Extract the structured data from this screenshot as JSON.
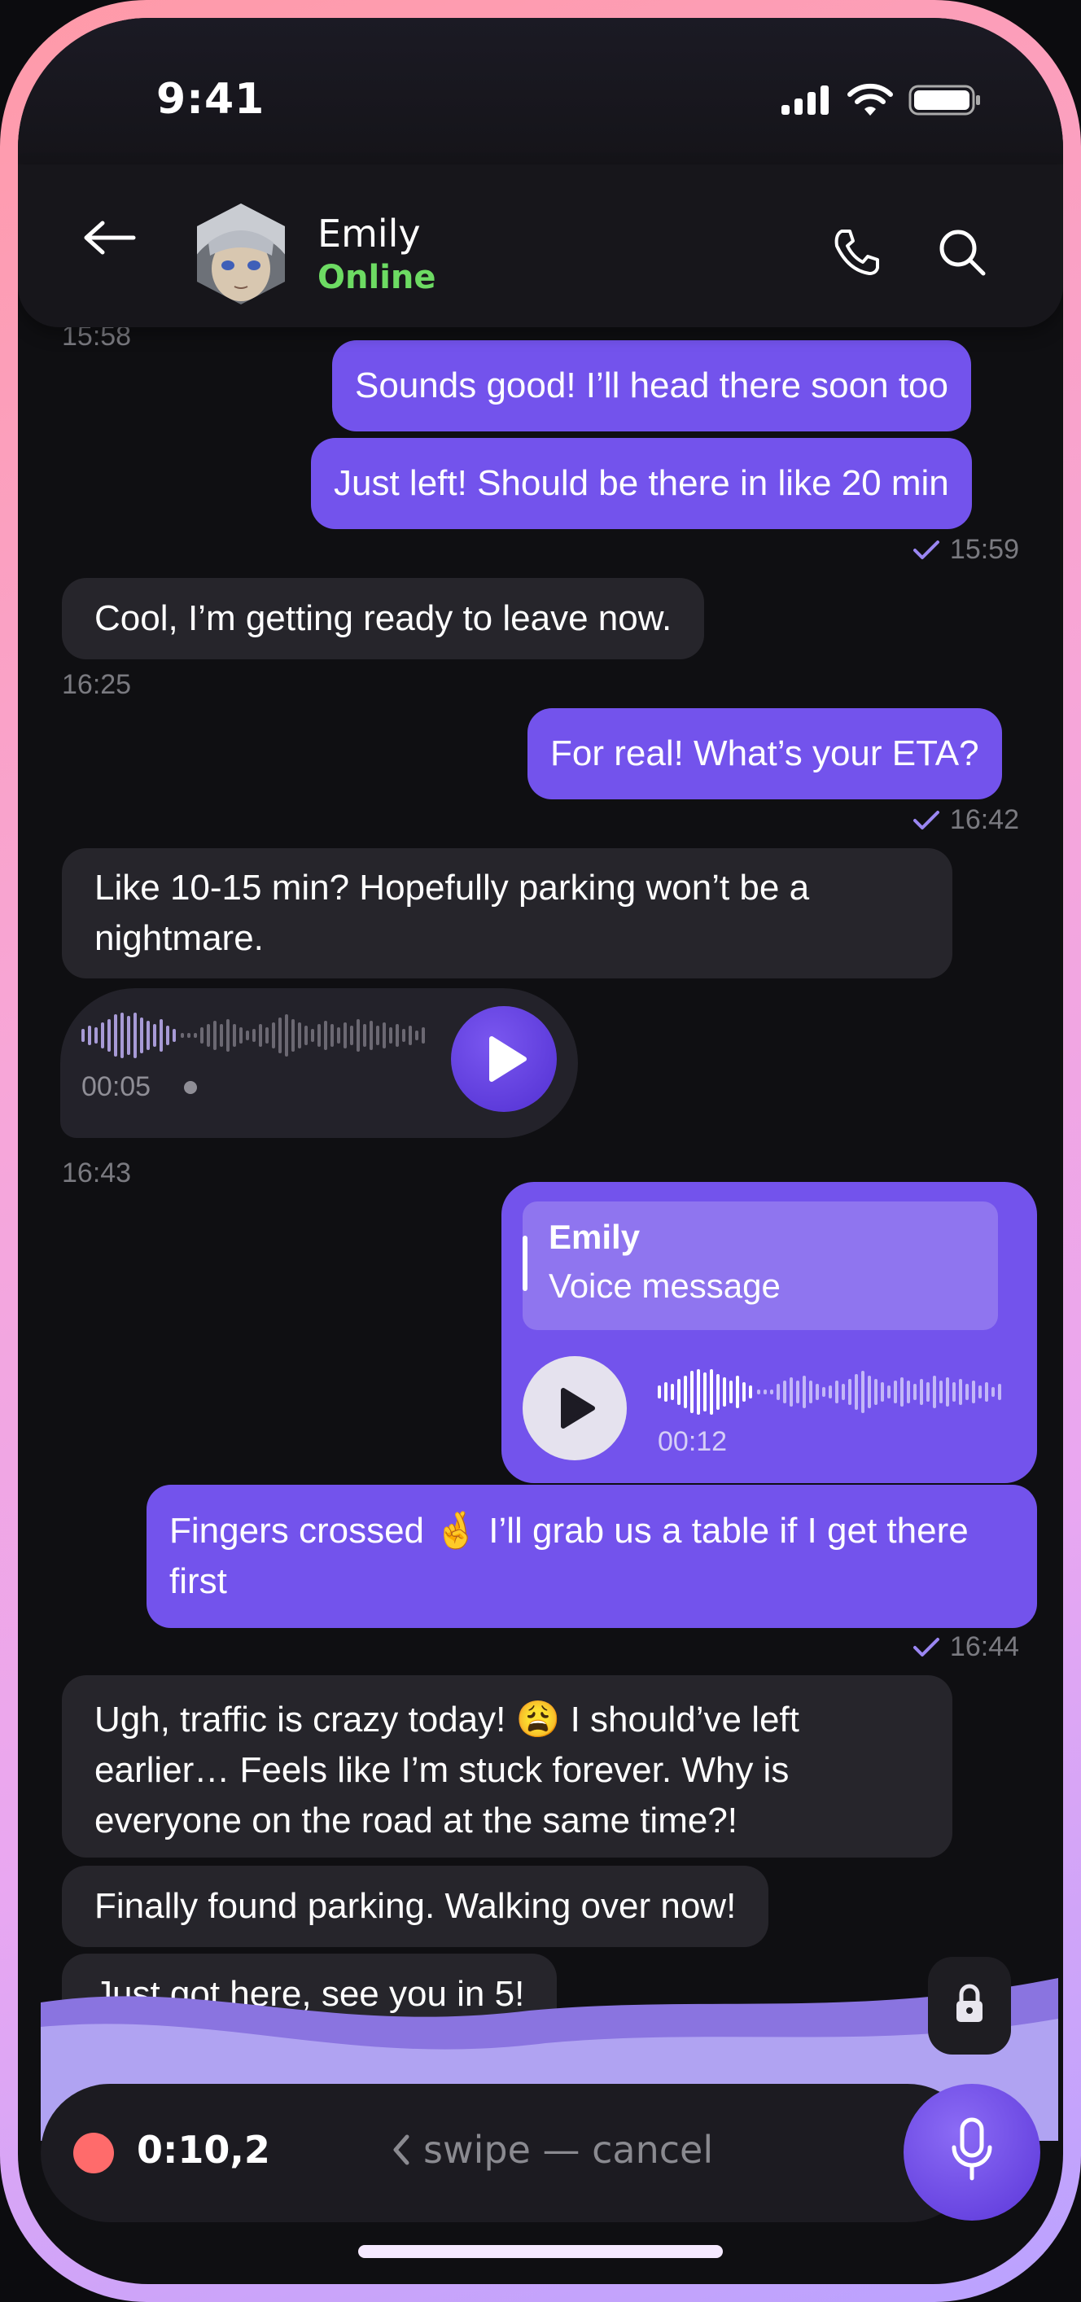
{
  "status_bar": {
    "time": "9:41"
  },
  "header": {
    "contact_name": "Emily",
    "contact_status": "Online"
  },
  "colors": {
    "accent": "#7353ec",
    "online": "#6ddb63",
    "record_dot": "#ff6b6b",
    "incoming_bubble": "#26252b"
  },
  "clipped_timestamp": "15:58",
  "messages": [
    {
      "id": "m1",
      "side": "out",
      "text": "Sounds good! I’ll head there soon too"
    },
    {
      "id": "m2",
      "side": "out",
      "text": "Just left! Should be there in like 20 min",
      "time": "15:59"
    },
    {
      "id": "m3",
      "side": "in",
      "text": "Cool, I’m getting ready to leave now.",
      "time": "16:25"
    },
    {
      "id": "m4",
      "side": "out",
      "text": "For real! What’s your ETA?",
      "time": "16:42"
    },
    {
      "id": "m5",
      "side": "in",
      "text": "Like 10-15 min? Hopefully parking won’t be a nightmare."
    },
    {
      "id": "m8",
      "side": "out",
      "text": "Fingers crossed 🤞 I’ll grab us a table if I get there first",
      "time": "16:44"
    },
    {
      "id": "m9",
      "side": "in",
      "text": "Ugh, traffic is crazy today! 😩 I should’ve left earlier… Feels like I’m stuck forever. Why is everyone on the road at the same time?!"
    },
    {
      "id": "m10",
      "side": "in",
      "text": "Finally found parking. Walking over now!"
    },
    {
      "id": "m11",
      "side": "in",
      "text": "Just got here, see you in 5!"
    }
  ],
  "voice_incoming": {
    "duration": "00:05",
    "time": "16:43",
    "icon": "play-icon"
  },
  "voice_outgoing": {
    "reply_name": "Emily",
    "reply_text": "Voice message",
    "duration": "00:12",
    "icon": "play-icon"
  },
  "recording": {
    "elapsed": "0:10,2",
    "hint": "swipe — cancel",
    "icons": [
      "lock-icon",
      "microphone-icon",
      "chevron-left-icon"
    ]
  }
}
